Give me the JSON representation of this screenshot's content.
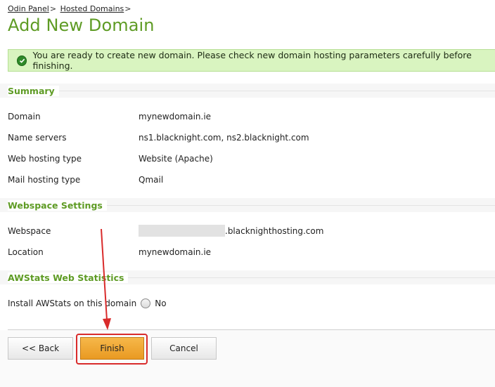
{
  "breadcrumbs": {
    "item1": "Odin Panel",
    "item2": "Hosted Domains",
    "separator": ">"
  },
  "page_title": "Add New Domain",
  "notice": "You are ready to create new domain. Please check new domain hosting parameters carefully before finishing.",
  "summary": {
    "title": "Summary",
    "rows": [
      {
        "label": "Domain",
        "value": "mynewdomain.ie"
      },
      {
        "label": "Name servers",
        "value": "ns1.blacknight.com, ns2.blacknight.com"
      },
      {
        "label": "Web hosting type",
        "value": "Website (Apache)"
      },
      {
        "label": "Mail hosting type",
        "value": "Qmail"
      }
    ]
  },
  "webspace": {
    "title": "Webspace Settings",
    "webspace_label": "Webspace",
    "webspace_suffix": ".blacknighthosting.com",
    "location_label": "Location",
    "location_value": "mynewdomain.ie"
  },
  "awstats": {
    "title": "AWStats Web Statistics",
    "install_label": "Install AWStats on this domain",
    "option": "No"
  },
  "buttons": {
    "back": "<< Back",
    "finish": "Finish",
    "cancel": "Cancel"
  },
  "colors": {
    "accent": "#5e9b24",
    "annotation": "#d92b2b",
    "primary_button": "#eea22c"
  }
}
